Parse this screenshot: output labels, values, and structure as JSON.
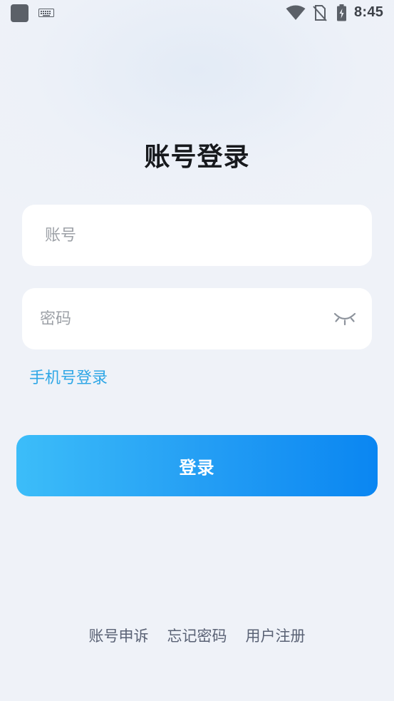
{
  "status_bar": {
    "time": "8:45",
    "icons": [
      "app-square-icon",
      "keyboard-icon",
      "wifi-icon",
      "no-sim-icon",
      "battery-charging-icon"
    ]
  },
  "login": {
    "title": "账号登录",
    "account_placeholder": "账号",
    "password_placeholder": "密码",
    "password_toggle_icon": "eye-closed-icon",
    "phone_login_link": "手机号登录",
    "submit_label": "登录"
  },
  "footer": {
    "appeal": "账号申诉",
    "forgot_password": "忘记密码",
    "register": "用户注册"
  },
  "colors": {
    "accent_link": "#2fa7e6",
    "button_gradient_start": "#3cbdf9",
    "button_gradient_end": "#0a86f2",
    "footer_text": "#5a6275"
  }
}
